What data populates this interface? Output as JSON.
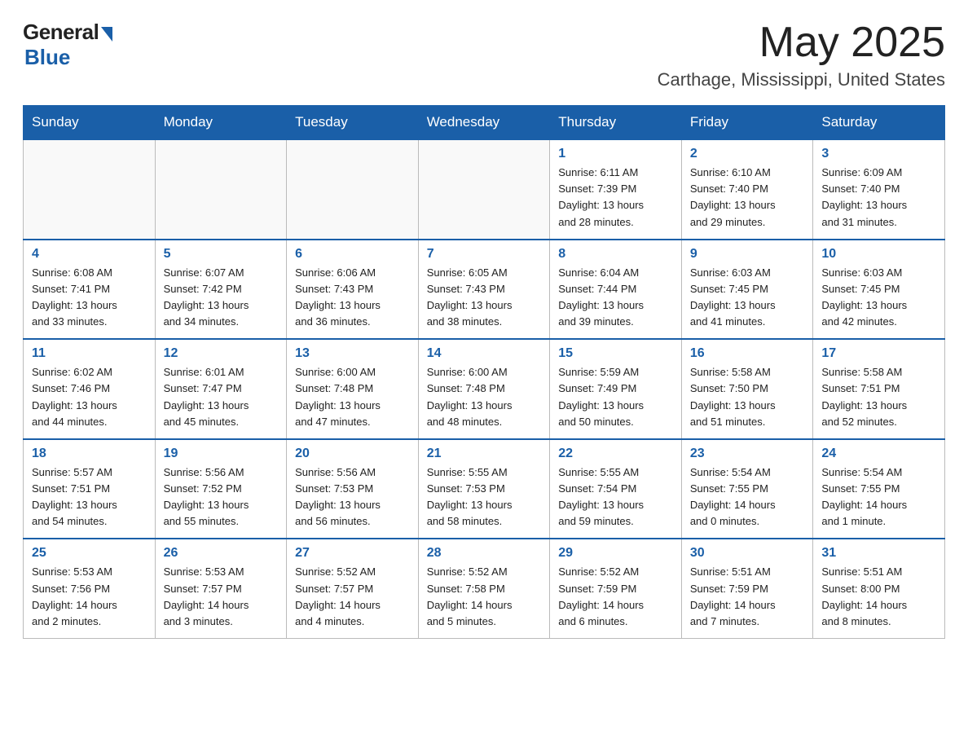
{
  "header": {
    "logo_general": "General",
    "logo_blue": "Blue",
    "month": "May 2025",
    "location": "Carthage, Mississippi, United States"
  },
  "days_of_week": [
    "Sunday",
    "Monday",
    "Tuesday",
    "Wednesday",
    "Thursday",
    "Friday",
    "Saturday"
  ],
  "weeks": [
    [
      {
        "day": "",
        "info": ""
      },
      {
        "day": "",
        "info": ""
      },
      {
        "day": "",
        "info": ""
      },
      {
        "day": "",
        "info": ""
      },
      {
        "day": "1",
        "info": "Sunrise: 6:11 AM\nSunset: 7:39 PM\nDaylight: 13 hours\nand 28 minutes."
      },
      {
        "day": "2",
        "info": "Sunrise: 6:10 AM\nSunset: 7:40 PM\nDaylight: 13 hours\nand 29 minutes."
      },
      {
        "day": "3",
        "info": "Sunrise: 6:09 AM\nSunset: 7:40 PM\nDaylight: 13 hours\nand 31 minutes."
      }
    ],
    [
      {
        "day": "4",
        "info": "Sunrise: 6:08 AM\nSunset: 7:41 PM\nDaylight: 13 hours\nand 33 minutes."
      },
      {
        "day": "5",
        "info": "Sunrise: 6:07 AM\nSunset: 7:42 PM\nDaylight: 13 hours\nand 34 minutes."
      },
      {
        "day": "6",
        "info": "Sunrise: 6:06 AM\nSunset: 7:43 PM\nDaylight: 13 hours\nand 36 minutes."
      },
      {
        "day": "7",
        "info": "Sunrise: 6:05 AM\nSunset: 7:43 PM\nDaylight: 13 hours\nand 38 minutes."
      },
      {
        "day": "8",
        "info": "Sunrise: 6:04 AM\nSunset: 7:44 PM\nDaylight: 13 hours\nand 39 minutes."
      },
      {
        "day": "9",
        "info": "Sunrise: 6:03 AM\nSunset: 7:45 PM\nDaylight: 13 hours\nand 41 minutes."
      },
      {
        "day": "10",
        "info": "Sunrise: 6:03 AM\nSunset: 7:45 PM\nDaylight: 13 hours\nand 42 minutes."
      }
    ],
    [
      {
        "day": "11",
        "info": "Sunrise: 6:02 AM\nSunset: 7:46 PM\nDaylight: 13 hours\nand 44 minutes."
      },
      {
        "day": "12",
        "info": "Sunrise: 6:01 AM\nSunset: 7:47 PM\nDaylight: 13 hours\nand 45 minutes."
      },
      {
        "day": "13",
        "info": "Sunrise: 6:00 AM\nSunset: 7:48 PM\nDaylight: 13 hours\nand 47 minutes."
      },
      {
        "day": "14",
        "info": "Sunrise: 6:00 AM\nSunset: 7:48 PM\nDaylight: 13 hours\nand 48 minutes."
      },
      {
        "day": "15",
        "info": "Sunrise: 5:59 AM\nSunset: 7:49 PM\nDaylight: 13 hours\nand 50 minutes."
      },
      {
        "day": "16",
        "info": "Sunrise: 5:58 AM\nSunset: 7:50 PM\nDaylight: 13 hours\nand 51 minutes."
      },
      {
        "day": "17",
        "info": "Sunrise: 5:58 AM\nSunset: 7:51 PM\nDaylight: 13 hours\nand 52 minutes."
      }
    ],
    [
      {
        "day": "18",
        "info": "Sunrise: 5:57 AM\nSunset: 7:51 PM\nDaylight: 13 hours\nand 54 minutes."
      },
      {
        "day": "19",
        "info": "Sunrise: 5:56 AM\nSunset: 7:52 PM\nDaylight: 13 hours\nand 55 minutes."
      },
      {
        "day": "20",
        "info": "Sunrise: 5:56 AM\nSunset: 7:53 PM\nDaylight: 13 hours\nand 56 minutes."
      },
      {
        "day": "21",
        "info": "Sunrise: 5:55 AM\nSunset: 7:53 PM\nDaylight: 13 hours\nand 58 minutes."
      },
      {
        "day": "22",
        "info": "Sunrise: 5:55 AM\nSunset: 7:54 PM\nDaylight: 13 hours\nand 59 minutes."
      },
      {
        "day": "23",
        "info": "Sunrise: 5:54 AM\nSunset: 7:55 PM\nDaylight: 14 hours\nand 0 minutes."
      },
      {
        "day": "24",
        "info": "Sunrise: 5:54 AM\nSunset: 7:55 PM\nDaylight: 14 hours\nand 1 minute."
      }
    ],
    [
      {
        "day": "25",
        "info": "Sunrise: 5:53 AM\nSunset: 7:56 PM\nDaylight: 14 hours\nand 2 minutes."
      },
      {
        "day": "26",
        "info": "Sunrise: 5:53 AM\nSunset: 7:57 PM\nDaylight: 14 hours\nand 3 minutes."
      },
      {
        "day": "27",
        "info": "Sunrise: 5:52 AM\nSunset: 7:57 PM\nDaylight: 14 hours\nand 4 minutes."
      },
      {
        "day": "28",
        "info": "Sunrise: 5:52 AM\nSunset: 7:58 PM\nDaylight: 14 hours\nand 5 minutes."
      },
      {
        "day": "29",
        "info": "Sunrise: 5:52 AM\nSunset: 7:59 PM\nDaylight: 14 hours\nand 6 minutes."
      },
      {
        "day": "30",
        "info": "Sunrise: 5:51 AM\nSunset: 7:59 PM\nDaylight: 14 hours\nand 7 minutes."
      },
      {
        "day": "31",
        "info": "Sunrise: 5:51 AM\nSunset: 8:00 PM\nDaylight: 14 hours\nand 8 minutes."
      }
    ]
  ]
}
